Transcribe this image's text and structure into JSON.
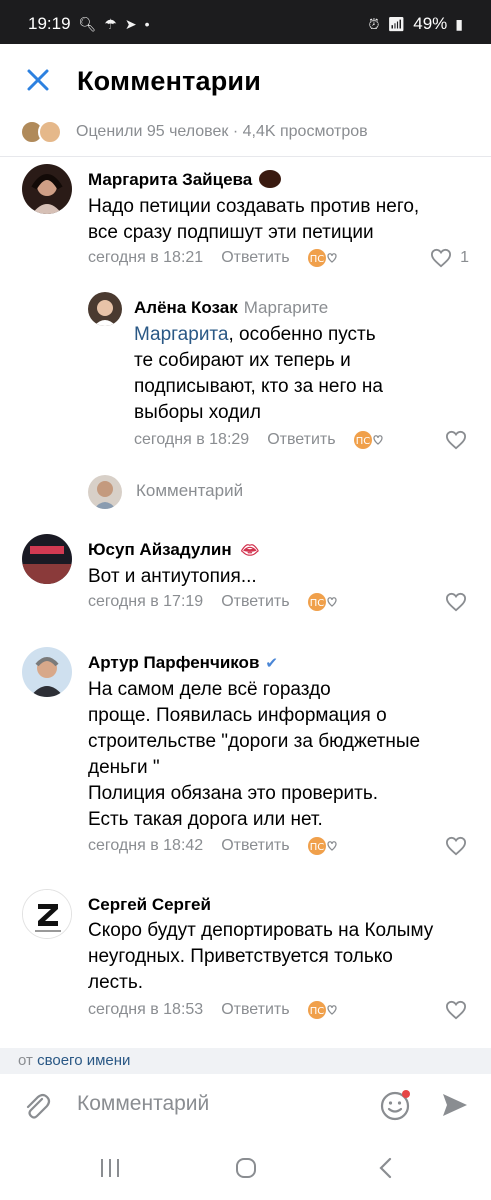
{
  "status_bar": {
    "time": "19:19",
    "battery": "49%"
  },
  "header": {
    "title": "Комментарии",
    "meta": "Оценили 95 человек · 4,4K просмотров"
  },
  "comments": [
    {
      "name": "Маргарита Зайцева",
      "text_lines": [
        "Надо петиции создавать против него,",
        "все сразу подпишут эти петиции"
      ],
      "time": "сегодня в 18:21",
      "reply_label": "Ответить",
      "likes": "1"
    },
    {
      "name": "Алёна Козак",
      "reply_to": "Маргарите",
      "mention": "Маргарита",
      "text_lines": [
        ", особенно пусть",
        "те собирают их теперь и",
        "подписывают, кто за него на",
        "выборы ходил"
      ],
      "time": "сегодня в 18:29",
      "reply_label": "Ответить"
    },
    {
      "name": "Юсуп Айзадулин",
      "text_lines": [
        "Вот и антиутопия..."
      ],
      "time": "сегодня в 17:19",
      "reply_label": "Ответить"
    },
    {
      "name": "Артур Парфенчиков",
      "text_lines": [
        "На самом деле всё гораздо",
        "проще. Появилась информация о",
        "строительстве \"дороги за бюджетные",
        "деньги \"",
        "Полиция обязана это проверить.",
        "Есть такая дорога или нет."
      ],
      "time": "сегодня в 18:42",
      "reply_label": "Ответить"
    },
    {
      "name": "Сергей Сергей",
      "text_lines": [
        "Скоро будут депортировать на Колыму",
        "неугодных. Приветствуется только",
        "лесть."
      ],
      "time": "сегодня в 18:53",
      "reply_label": "Ответить"
    }
  ],
  "reply_composer": {
    "placeholder": "Комментарий"
  },
  "bottom": {
    "from_prefix": "от",
    "from_link": "своего имени"
  },
  "composer": {
    "placeholder": "Комментарий"
  },
  "colors": {
    "accent": "#2a5885",
    "muted": "#8a8d91",
    "heart": "#8a8d91",
    "verified": "#4a86d6",
    "send": "#8a8d91"
  },
  "icons": [
    "close-icon",
    "attach-icon",
    "emoji-icon",
    "send-icon",
    "heart-icon",
    "reaction-icon",
    "verified-icon",
    "nav-recent-icon",
    "nav-home-icon",
    "nav-back-icon"
  ]
}
